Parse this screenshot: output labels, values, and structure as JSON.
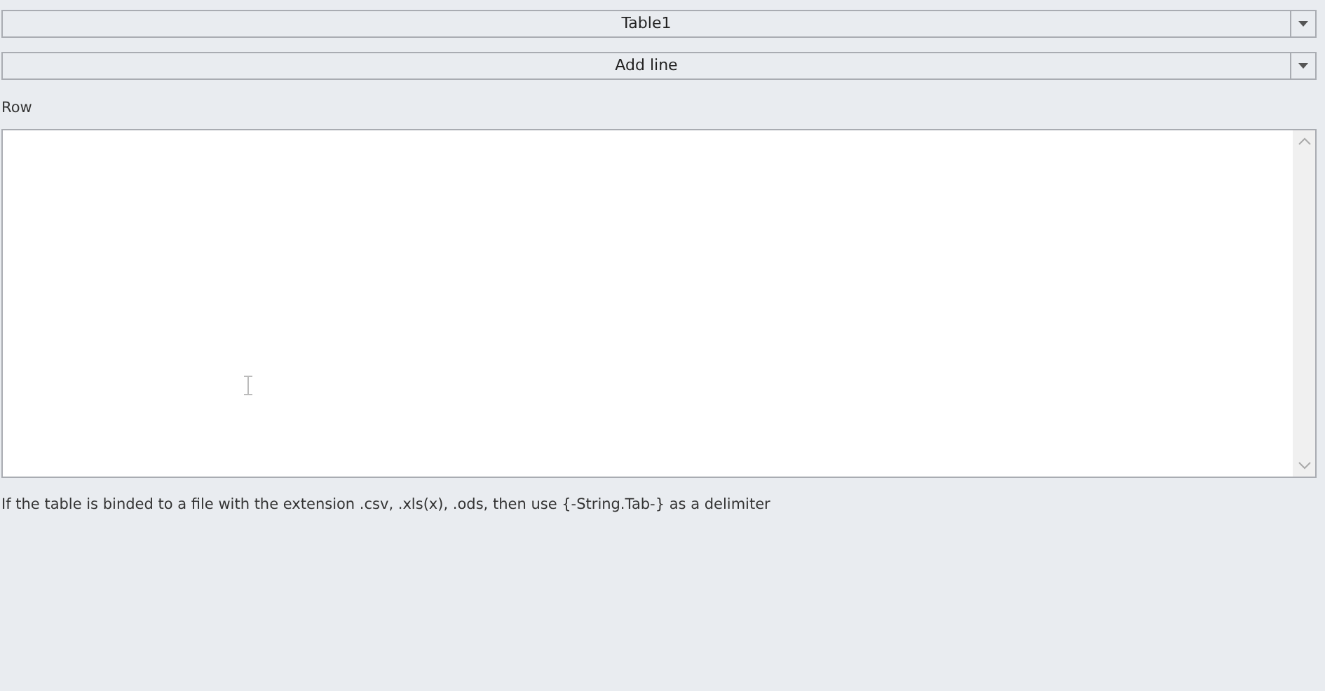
{
  "table_dropdown": {
    "value": "Table1"
  },
  "action_dropdown": {
    "value": "Add line"
  },
  "row_field": {
    "label": "Row"
  },
  "note": "If the table is binded to a file with the extension .csv, .xls(x), .ods, then use {-String.Tab-} as a delimiter"
}
